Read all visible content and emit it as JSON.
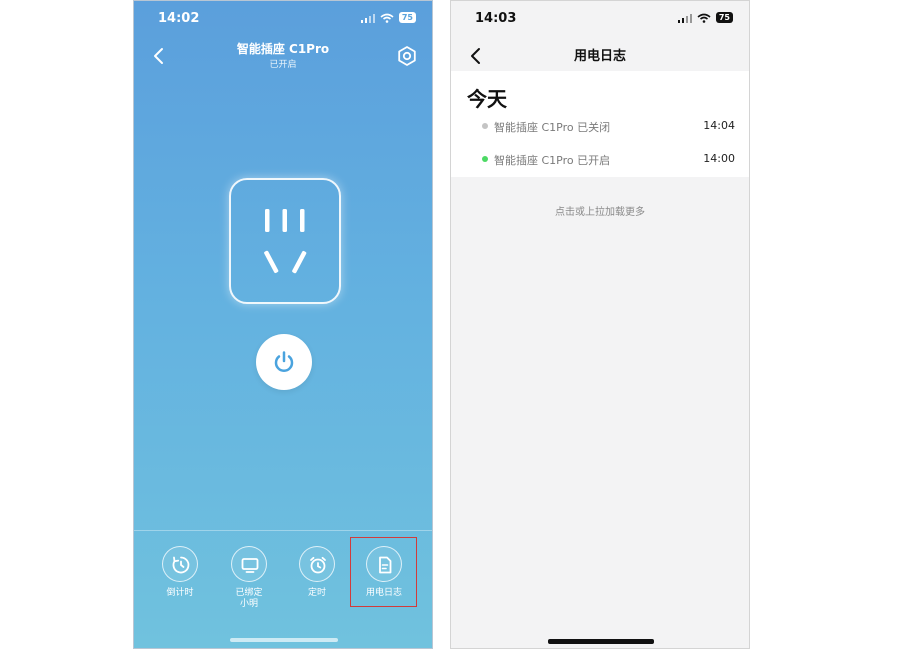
{
  "left": {
    "status": {
      "time": "14:02",
      "battery": "75"
    },
    "nav": {
      "title": "智能插座 C1Pro",
      "subtitle": "已开启"
    },
    "bottom_bar": [
      {
        "label": "倒计时",
        "icon": "countdown-icon"
      },
      {
        "label": "已绑定\n小明",
        "icon": "monitor-icon"
      },
      {
        "label": "定时",
        "icon": "alarm-clock-icon"
      },
      {
        "label": "用电日志",
        "icon": "document-icon"
      }
    ],
    "colors": {
      "background_top": "#5b9fdc",
      "background_bottom": "#70c2de",
      "accent": "#5aa3dc",
      "highlight": "#d23b3b"
    }
  },
  "right": {
    "status": {
      "time": "14:03",
      "battery": "75"
    },
    "nav": {
      "title": "用电日志"
    },
    "section_title": "今天",
    "logs": [
      {
        "text": "智能插座 C1Pro 已关闭",
        "time": "14:04",
        "dot_color": "#c4c4c4"
      },
      {
        "text": "智能插座 C1Pro 已开启",
        "time": "14:00",
        "dot_color": "#4cd964"
      }
    ],
    "load_more": "点击或上拉加载更多"
  }
}
